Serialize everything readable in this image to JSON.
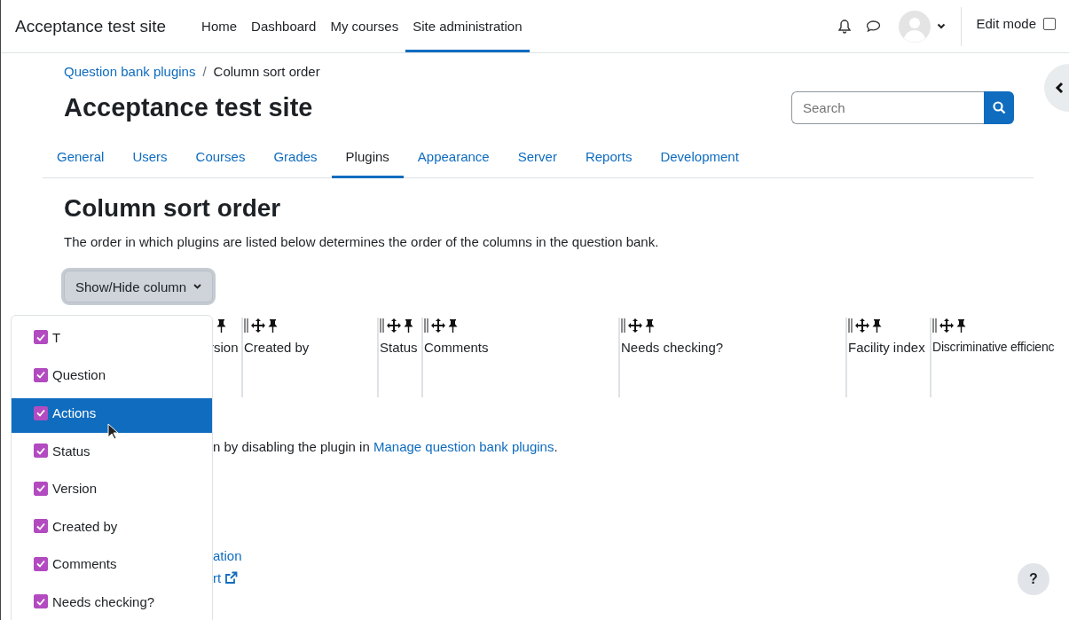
{
  "navbar": {
    "site_name": "Acceptance test site",
    "links": [
      {
        "label": "Home",
        "selected": false
      },
      {
        "label": "Dashboard",
        "selected": false
      },
      {
        "label": "My courses",
        "selected": false
      },
      {
        "label": "Site administration",
        "selected": true
      }
    ],
    "edit_mode": {
      "label": "Edit mode",
      "checked": false
    }
  },
  "breadcrumb": [
    {
      "label": "Question bank plugins",
      "link": true
    },
    {
      "label": "Column sort order",
      "link": false
    }
  ],
  "breadcrumb_separator": "/",
  "page_title": "Acceptance test site",
  "search": {
    "placeholder": "Search"
  },
  "tabs": [
    {
      "label": "General",
      "selected": false
    },
    {
      "label": "Users",
      "selected": false
    },
    {
      "label": "Courses",
      "selected": false
    },
    {
      "label": "Grades",
      "selected": false
    },
    {
      "label": "Plugins",
      "selected": true
    },
    {
      "label": "Appearance",
      "selected": false
    },
    {
      "label": "Server",
      "selected": false
    },
    {
      "label": "Reports",
      "selected": false
    },
    {
      "label": "Development",
      "selected": false
    }
  ],
  "heading": "Column sort order",
  "description": "The order in which plugins are listed below determines the order of the columns in the question bank.",
  "show_hide_button": "Show/Hide column",
  "columns": [
    {
      "label": "rsion",
      "move_icon": false
    },
    {
      "label": "Created by",
      "move_icon": true
    },
    {
      "label": "Status",
      "move_icon": true
    },
    {
      "label": "Comments",
      "move_icon": true
    },
    {
      "label": "Needs checking?",
      "move_icon": true
    },
    {
      "label": "Facility index",
      "move_icon": true
    },
    {
      "label": "Discriminative efficienc",
      "move_icon": true
    }
  ],
  "note": {
    "text": "n by disabling the plugin in ",
    "link": "Manage question bank plugins",
    "end": "."
  },
  "links": [
    {
      "label": "ation",
      "external": false
    },
    {
      "label": "rt",
      "external": true
    }
  ],
  "dropdown": [
    {
      "label": "T",
      "checked": true,
      "selected": false
    },
    {
      "label": "Question",
      "checked": true,
      "selected": false
    },
    {
      "label": "Actions",
      "checked": true,
      "selected": true
    },
    {
      "label": "Status",
      "checked": true,
      "selected": false
    },
    {
      "label": "Version",
      "checked": true,
      "selected": false
    },
    {
      "label": "Created by",
      "checked": true,
      "selected": false
    },
    {
      "label": "Comments",
      "checked": true,
      "selected": false
    },
    {
      "label": "Needs checking?",
      "checked": true,
      "selected": false
    }
  ],
  "help_button": "?"
}
